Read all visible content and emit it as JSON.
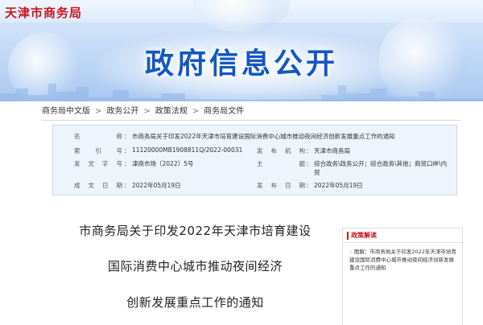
{
  "site": {
    "logo_text": "天津市商务局",
    "banner_title": "政府信息公开"
  },
  "breadcrumb": {
    "items": [
      "商务局中文版",
      "政务公开",
      "政策法规",
      "商务局文件"
    ],
    "separator": ">"
  },
  "info": {
    "name_label": "名 称",
    "name_value": "市商务局关于印发2022年天津市培育建设国际消费中心城市推动夜间经济创新发展重点工作的通知",
    "index_label": "索 引 号",
    "index_value": "11120000MB1908811Q/2022-00031",
    "issuer_label": "发布机构",
    "issuer_value": "天津市商务局",
    "docno_label": "发文字号",
    "docno_value": "津商市场〔2022〕5号",
    "subject_label": "主 题",
    "subject_value": "综合政务\\政务公开；综合政务\\其他；商贸口岸\\内贸",
    "created_label": "成文日期",
    "created_value": "2022年05月19日",
    "published_label": "发布日期",
    "published_value": "2022年05月19日"
  },
  "document": {
    "title_line1": "市商务局关于印发2022年天津市培育建设",
    "title_line2": "国际消费中心城市推动夜间经济",
    "title_line3": "创新发展重点工作的通知"
  },
  "side_panel": {
    "heading": "政策解读",
    "bullet": "◦",
    "item_text": "图解：市商务局关于印发2022年天津市培育建设国际消费中心城市推动夜间经济创新发展重点工作的通知"
  },
  "colors": {
    "brand_red": "#c8161d",
    "banner_blue": "#1457c4",
    "info_bg": "#eef4fb"
  }
}
